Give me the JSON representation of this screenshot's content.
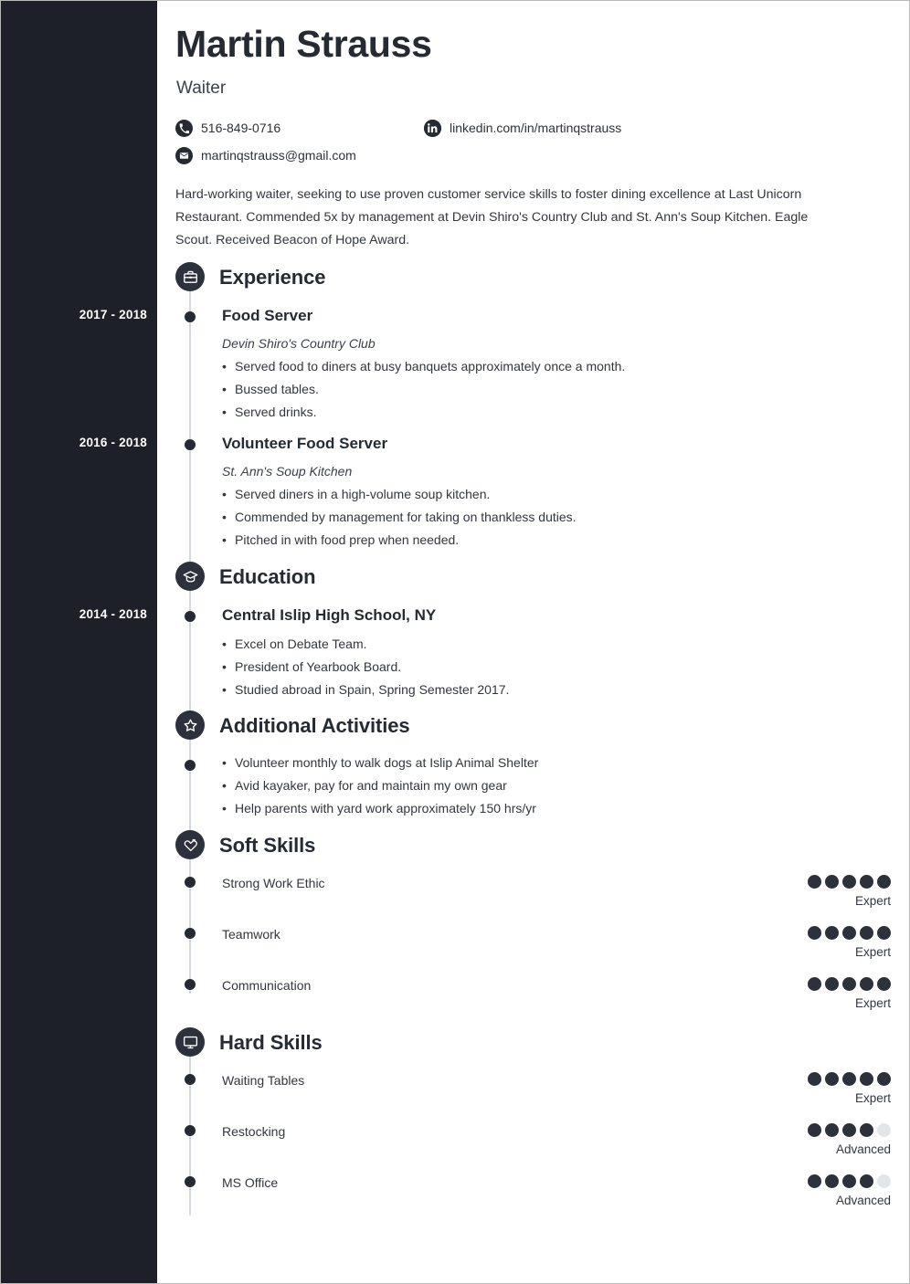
{
  "theme": {
    "sidebar_bg": "#1e2029",
    "ink": "#252a33",
    "body_text": "#32363e",
    "rule": "#d5d8dc",
    "dot_on": "#2c313c",
    "dot_off": "#e3e6e9"
  },
  "header": {
    "name": "Martin Strauss",
    "job_title": "Waiter",
    "contacts": [
      {
        "icon": "phone-icon",
        "value": "516-849-0716"
      },
      {
        "icon": "linkedin-icon",
        "value": "linkedin.com/in/martinqstrauss"
      },
      {
        "icon": "email-icon",
        "value": "martinqstrauss@gmail.com"
      }
    ]
  },
  "summary": "Hard-working waiter, seeking to use proven customer service skills to foster dining excellence at Last Unicorn Restaurant. Commended 5x by management at Devin Shiro's Country Club and St. Ann's Soup Kitchen. Eagle Scout. Received Beacon of Hope Award.",
  "sections": {
    "experience": {
      "title": "Experience",
      "icon": "briefcase-icon",
      "entries": [
        {
          "date": "2017 - 2018",
          "title": "Food Server",
          "subtitle": "Devin Shiro's Country Club",
          "bullets": [
            "Served food to diners at busy banquets approximately once a month.",
            "Bussed tables.",
            "Served drinks."
          ]
        },
        {
          "date": "2016 - 2018",
          "title": "Volunteer Food Server",
          "subtitle": "St. Ann's Soup Kitchen",
          "bullets": [
            "Served diners in a high-volume soup kitchen.",
            "Commended by management for taking on thankless duties.",
            "Pitched in with food prep when needed."
          ]
        }
      ]
    },
    "education": {
      "title": "Education",
      "icon": "graduation-cap-icon",
      "entries": [
        {
          "date": "2014 - 2018",
          "title": "Central Islip High School, NY",
          "bullets": [
            "Excel on Debate Team.",
            "President of Yearbook Board.",
            "Studied abroad in Spain, Spring Semester 2017."
          ]
        }
      ]
    },
    "activities": {
      "title": "Additional Activities",
      "icon": "star-icon",
      "bullets": [
        "Volunteer monthly to walk dogs at Islip Animal Shelter",
        "Avid kayaker, pay for and maintain my own gear",
        "Help parents with yard work approximately 150 hrs/yr"
      ]
    },
    "soft_skills": {
      "title": "Soft Skills",
      "icon": "heart-hand-icon",
      "items": [
        {
          "name": "Strong Work Ethic",
          "filled": 5,
          "total": 5,
          "level": "Expert"
        },
        {
          "name": "Teamwork",
          "filled": 5,
          "total": 5,
          "level": "Expert"
        },
        {
          "name": "Communication",
          "filled": 5,
          "total": 5,
          "level": "Expert"
        }
      ]
    },
    "hard_skills": {
      "title": "Hard Skills",
      "icon": "monitor-icon",
      "items": [
        {
          "name": "Waiting Tables",
          "filled": 5,
          "total": 5,
          "level": "Expert"
        },
        {
          "name": "Restocking",
          "filled": 4,
          "total": 5,
          "level": "Advanced"
        },
        {
          "name": "MS Office",
          "filled": 4,
          "total": 5,
          "level": "Advanced"
        }
      ]
    }
  }
}
